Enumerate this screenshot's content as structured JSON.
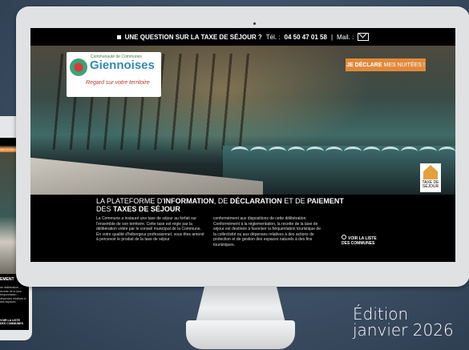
{
  "topbar": {
    "question": "UNE QUESTION SUR LA TAXE DE SÉJOUR ?",
    "tel_label": "Tél. :",
    "phone": "04 50 47 01 58",
    "separator": "|",
    "mail_label": "Mail. :"
  },
  "logo": {
    "small": "Communauté de Communes",
    "name": "Giennoises",
    "tagline": "Regard sur votre territoire"
  },
  "declare_button": {
    "bold": "JE DÉCLARE",
    "rest": "MES NUITÉES !"
  },
  "heading": {
    "part1": "LA PLATEFORME D'",
    "bold1": "INFORMATION",
    "part2": ", DE ",
    "bold2": "DÉCLARATION",
    "part3": " ET DE ",
    "bold3": "PAIEMENT",
    "line2_prefix": "DES ",
    "bold4": "TAXES DE SÉJOUR"
  },
  "body": {
    "col1": "La Commune a instauré une taxe de séjour au forfait sur l'ensemble de son territoire. Cette taxe est régie par la délibération votée par le conseil municipal de la Commune. En votre qualité d'hébergeur professionnel, vous êtes amené à percevoir le produit de la taxe de séjour",
    "col2": "conformément aux dispositions de cette délibération. Conformément à la réglementation, la recette de la taxe de séjour est destinée à favoriser la fréquentation touristique de la collectivité ou aux dépenses relatives à des actions de protection et de gestion des espaces naturels à des fins touristiques."
  },
  "list_button": {
    "line1": "VOIR LA LISTE",
    "line2": "DES COMMUNES"
  },
  "badge": {
    "line1": "TAXE DE",
    "line2": "SÉJOUR"
  },
  "phone": {
    "button": "MES NUITÉES !",
    "heading": "EMENT",
    "text": "de délibération. ... recette de la taxe fréquentation ... dépenses relatives à des espaces",
    "list_line1": "VOIR LA LISTE",
    "list_line2": "DES COMMUNES"
  },
  "edition": {
    "line1": "Édition",
    "line2": "janvier 2026"
  },
  "colors": {
    "accent_orange": "#e08a3c",
    "badge_orange": "#e4a13a",
    "logo_blue": "#2f8bb0"
  }
}
